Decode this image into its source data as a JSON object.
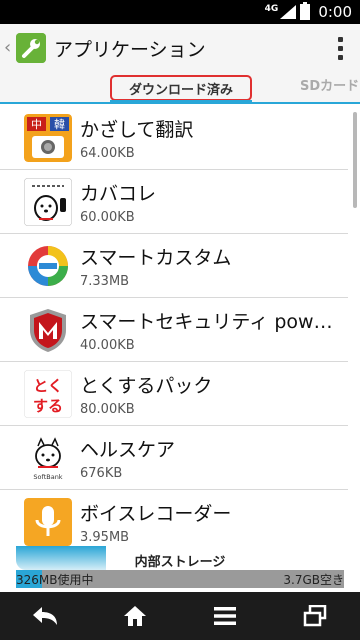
{
  "status_bar": {
    "network": "4G",
    "time": "0:00"
  },
  "action_bar": {
    "title": "アプリケーション"
  },
  "tabs": [
    {
      "label": "ダウンロード済み",
      "selected": true
    },
    {
      "label": "SDカード",
      "selected": false
    }
  ],
  "apps": [
    {
      "name": "かざして翻訳",
      "size": "64.00KB",
      "icon": "translate-camera-icon"
    },
    {
      "name": "カバコレ",
      "size": "60.00KB",
      "icon": "cover-collection-dog-icon"
    },
    {
      "name": "スマートカスタム",
      "size": "7.33MB",
      "icon": "smart-custom-icon"
    },
    {
      "name": "スマートセキュリティ powered by McAfee",
      "size": "40.00KB",
      "icon": "mcafee-shield-icon"
    },
    {
      "name": "とくするパック",
      "size": "80.00KB",
      "icon": "tokusuru-pack-icon"
    },
    {
      "name": "ヘルスケア",
      "size": "676KB",
      "icon": "softbank-dog-icon"
    },
    {
      "name": "ボイスレコーダー",
      "size": "3.95MB",
      "icon": "microphone-icon"
    }
  ],
  "storage": {
    "label": "内部ストレージ",
    "used": "326MB使用中",
    "free": "3.7GB空き",
    "used_fraction": 0.08
  },
  "colors": {
    "accent": "#29a7d8",
    "highlight_box": "#e03030"
  }
}
